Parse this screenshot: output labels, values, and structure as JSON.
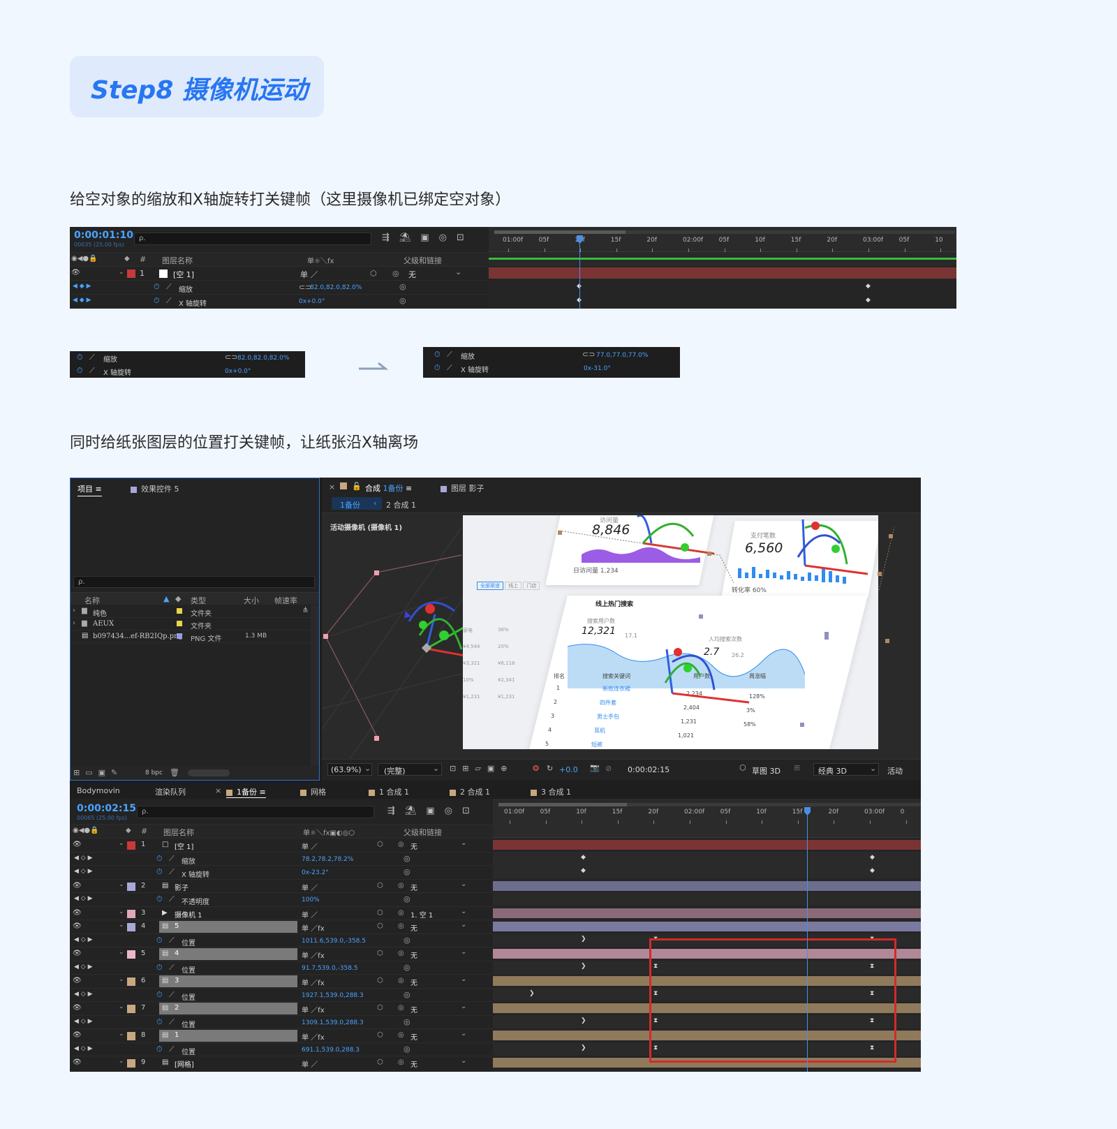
{
  "header": {
    "title": "Step8 摄像机运动"
  },
  "captions": {
    "one": "给空对象的缩放和X轴旋转打关键帧（这里摄像机已绑定空对象）",
    "two": "同时给纸张图层的位置打关键帧，让纸张沿X轴离场"
  },
  "timeline1": {
    "timecode": "0:00:01:10",
    "fps": "00035 (25.00 fps)",
    "search_placeholder": "ρ.",
    "col_layer_name": "图层名称",
    "col_switches": "单☼＼fx",
    "col_parent": "父级和链接",
    "col_num": "#",
    "layer_num": "1",
    "layer_name": "[空 1]",
    "parent_value": "无",
    "props": [
      {
        "name": "缩放",
        "value": "82.0,82.0,82.0%"
      },
      {
        "name": "X 轴旋转",
        "value": "0x+0.0°"
      }
    ],
    "ruler_labels": [
      "01:00f",
      "05f",
      "10f",
      "15f",
      "20f",
      "02:00f",
      "05f",
      "10f",
      "15f",
      "20f",
      "03:00f",
      "05f",
      "10"
    ]
  },
  "compare": {
    "before": [
      {
        "name": "缩放",
        "value": "82.0,82.0,82.0%"
      },
      {
        "name": "X 轴旋转",
        "value": "0x+0.0°"
      }
    ],
    "after": [
      {
        "name": "缩放",
        "value": "77.0,77.0,77.0%"
      },
      {
        "name": "X 轴旋转",
        "value": "0x-31.0°"
      }
    ],
    "arrow": "→"
  },
  "project_panel": {
    "tab_project": "项目",
    "tab_effects": "效果控件 5",
    "search_placeholder": "ρ.",
    "cols": [
      "名称",
      "类型",
      "大小",
      "帧速率"
    ],
    "items": [
      {
        "name": "纯色",
        "type": "文件夹",
        "size": "",
        "color": "#e8d44a"
      },
      {
        "name": "AEUX",
        "type": "文件夹",
        "size": "",
        "color": "#e8d44a"
      },
      {
        "name": "b097434...ef-RB2IQp.png",
        "type": "PNG 文件",
        "size": "1.3 MB",
        "color": "#9a9ae0"
      }
    ],
    "bpc": "8 bpc"
  },
  "composition": {
    "tab_comp_prefix": "合成",
    "tab_comp_name": "1备份",
    "tab_layer": "图层 影子",
    "crumb_active": "1备份",
    "crumb_next": "2 合成 1",
    "view_label": "活动摄像机 (摄像机 1)",
    "zoom": "(63.9%)",
    "quality": "(完整)",
    "exposure": "+0.0",
    "timecode": "0:00:02:15",
    "draft": "草图 3D",
    "renderer": "经典 3D",
    "active_cam": "活动",
    "cards": {
      "visits": "8,846",
      "visits_label": "访问量",
      "daily": "日访问量",
      "daily_val": "1,234",
      "pay_label": "支付笔数",
      "pay": "6,560",
      "conv": "转化率",
      "conv_val": "60%",
      "search_title": "线上热门搜索",
      "search_users_label": "搜索用户数",
      "search_users": "12,321",
      "search_users_delta": "17.1",
      "per_label": "人均搜索次数",
      "per": "2.7",
      "per_delta": "26.2",
      "filters": [
        "全部渠道",
        "线上",
        "门店"
      ],
      "table_headers": [
        "排名",
        "搜索关键词",
        "用户数",
        "周涨幅"
      ],
      "table_rows": [
        {
          "rank": "1",
          "kw": "新款连衣裙",
          "users": "2,234",
          "growth": "128%"
        },
        {
          "rank": "2",
          "kw": "四件套",
          "users": "2,404",
          "growth": "3%"
        },
        {
          "rank": "3",
          "kw": "男士手包",
          "users": "1,231",
          "growth": "58%"
        },
        {
          "rank": "4",
          "kw": "耳机",
          "users": "1,021",
          "growth": ""
        },
        {
          "rank": "5",
          "kw": "短裤",
          "users": "",
          "growth": ""
        }
      ],
      "side_labels": [
        "家电",
        "36%",
        "¥4,544",
        "20%",
        "¥3,321",
        "¥6,118",
        "10%",
        "¥2,341",
        "¥1,231",
        "¥1,231"
      ]
    }
  },
  "timeline2": {
    "tabs": [
      "Bodymovin",
      "渲染队列",
      "1备份",
      "网格",
      "1 合成 1",
      "2 合成 1",
      "3 合成 1"
    ],
    "timecode": "0:00:02:15",
    "fps": "00065 (25.00 fps)",
    "search_placeholder": "ρ.",
    "col_layer_name": "图层名称",
    "col_parent": "父级和链接",
    "col_num": "#",
    "ruler_labels": [
      "01:00f",
      "05f",
      "10f",
      "15f",
      "20f",
      "02:00f",
      "05f",
      "10f",
      "15f",
      "20f",
      "03:00f",
      "0"
    ],
    "rows": [
      {
        "kind": "layer",
        "num": "1",
        "name": "[空 1]",
        "parent": "无",
        "color": "#c83a3a",
        "bar": "#7a3434"
      },
      {
        "kind": "prop",
        "name": "缩放",
        "value": "78.2,78.2,78.2%"
      },
      {
        "kind": "prop",
        "name": "X 轴旋转",
        "value": "0x-23.2°"
      },
      {
        "kind": "layer",
        "num": "2",
        "name": "影子",
        "parent": "无",
        "color": "#a8a8d8",
        "bar": "#6d6d8f"
      },
      {
        "kind": "prop",
        "name": "不透明度",
        "value": "100%"
      },
      {
        "kind": "layer",
        "num": "3",
        "name": "摄像机 1",
        "parent": "1. 空 1",
        "color": "#e0a8b8",
        "bar": "#8a6a78"
      },
      {
        "kind": "layer",
        "num": "4",
        "name": "5",
        "parent": "无",
        "color": "#a8a8d8",
        "bar": "#7a7aa0"
      },
      {
        "kind": "prop",
        "name": "位置",
        "value": "1011.6,539.0,-358.5"
      },
      {
        "kind": "layer",
        "num": "5",
        "name": "4",
        "parent": "无",
        "color": "#e8b8c8",
        "bar": "#b08898"
      },
      {
        "kind": "prop",
        "name": "位置",
        "value": "91.7,539.0,-358.5"
      },
      {
        "kind": "layer",
        "num": "6",
        "name": "3",
        "parent": "无",
        "color": "#c8a880",
        "bar": "#8f7a5c"
      },
      {
        "kind": "prop",
        "name": "位置",
        "value": "1927.1,539.0,288.3"
      },
      {
        "kind": "layer",
        "num": "7",
        "name": "2",
        "parent": "无",
        "color": "#c8a880",
        "bar": "#8f7a5c"
      },
      {
        "kind": "prop",
        "name": "位置",
        "value": "1309.1,539.0,288.3"
      },
      {
        "kind": "layer",
        "num": "8",
        "name": "1",
        "parent": "无",
        "color": "#c8a880",
        "bar": "#8f7a5c"
      },
      {
        "kind": "prop",
        "name": "位置",
        "value": "691.1,539.0,288.3"
      },
      {
        "kind": "layer",
        "num": "9",
        "name": "[网格]",
        "parent": "无",
        "color": "#c8a880",
        "bar": "#8f7a5c"
      }
    ]
  },
  "colors": {
    "accent": "#2776f2",
    "playhead": "#4a8fe6",
    "highlight": "#d42a2a"
  }
}
